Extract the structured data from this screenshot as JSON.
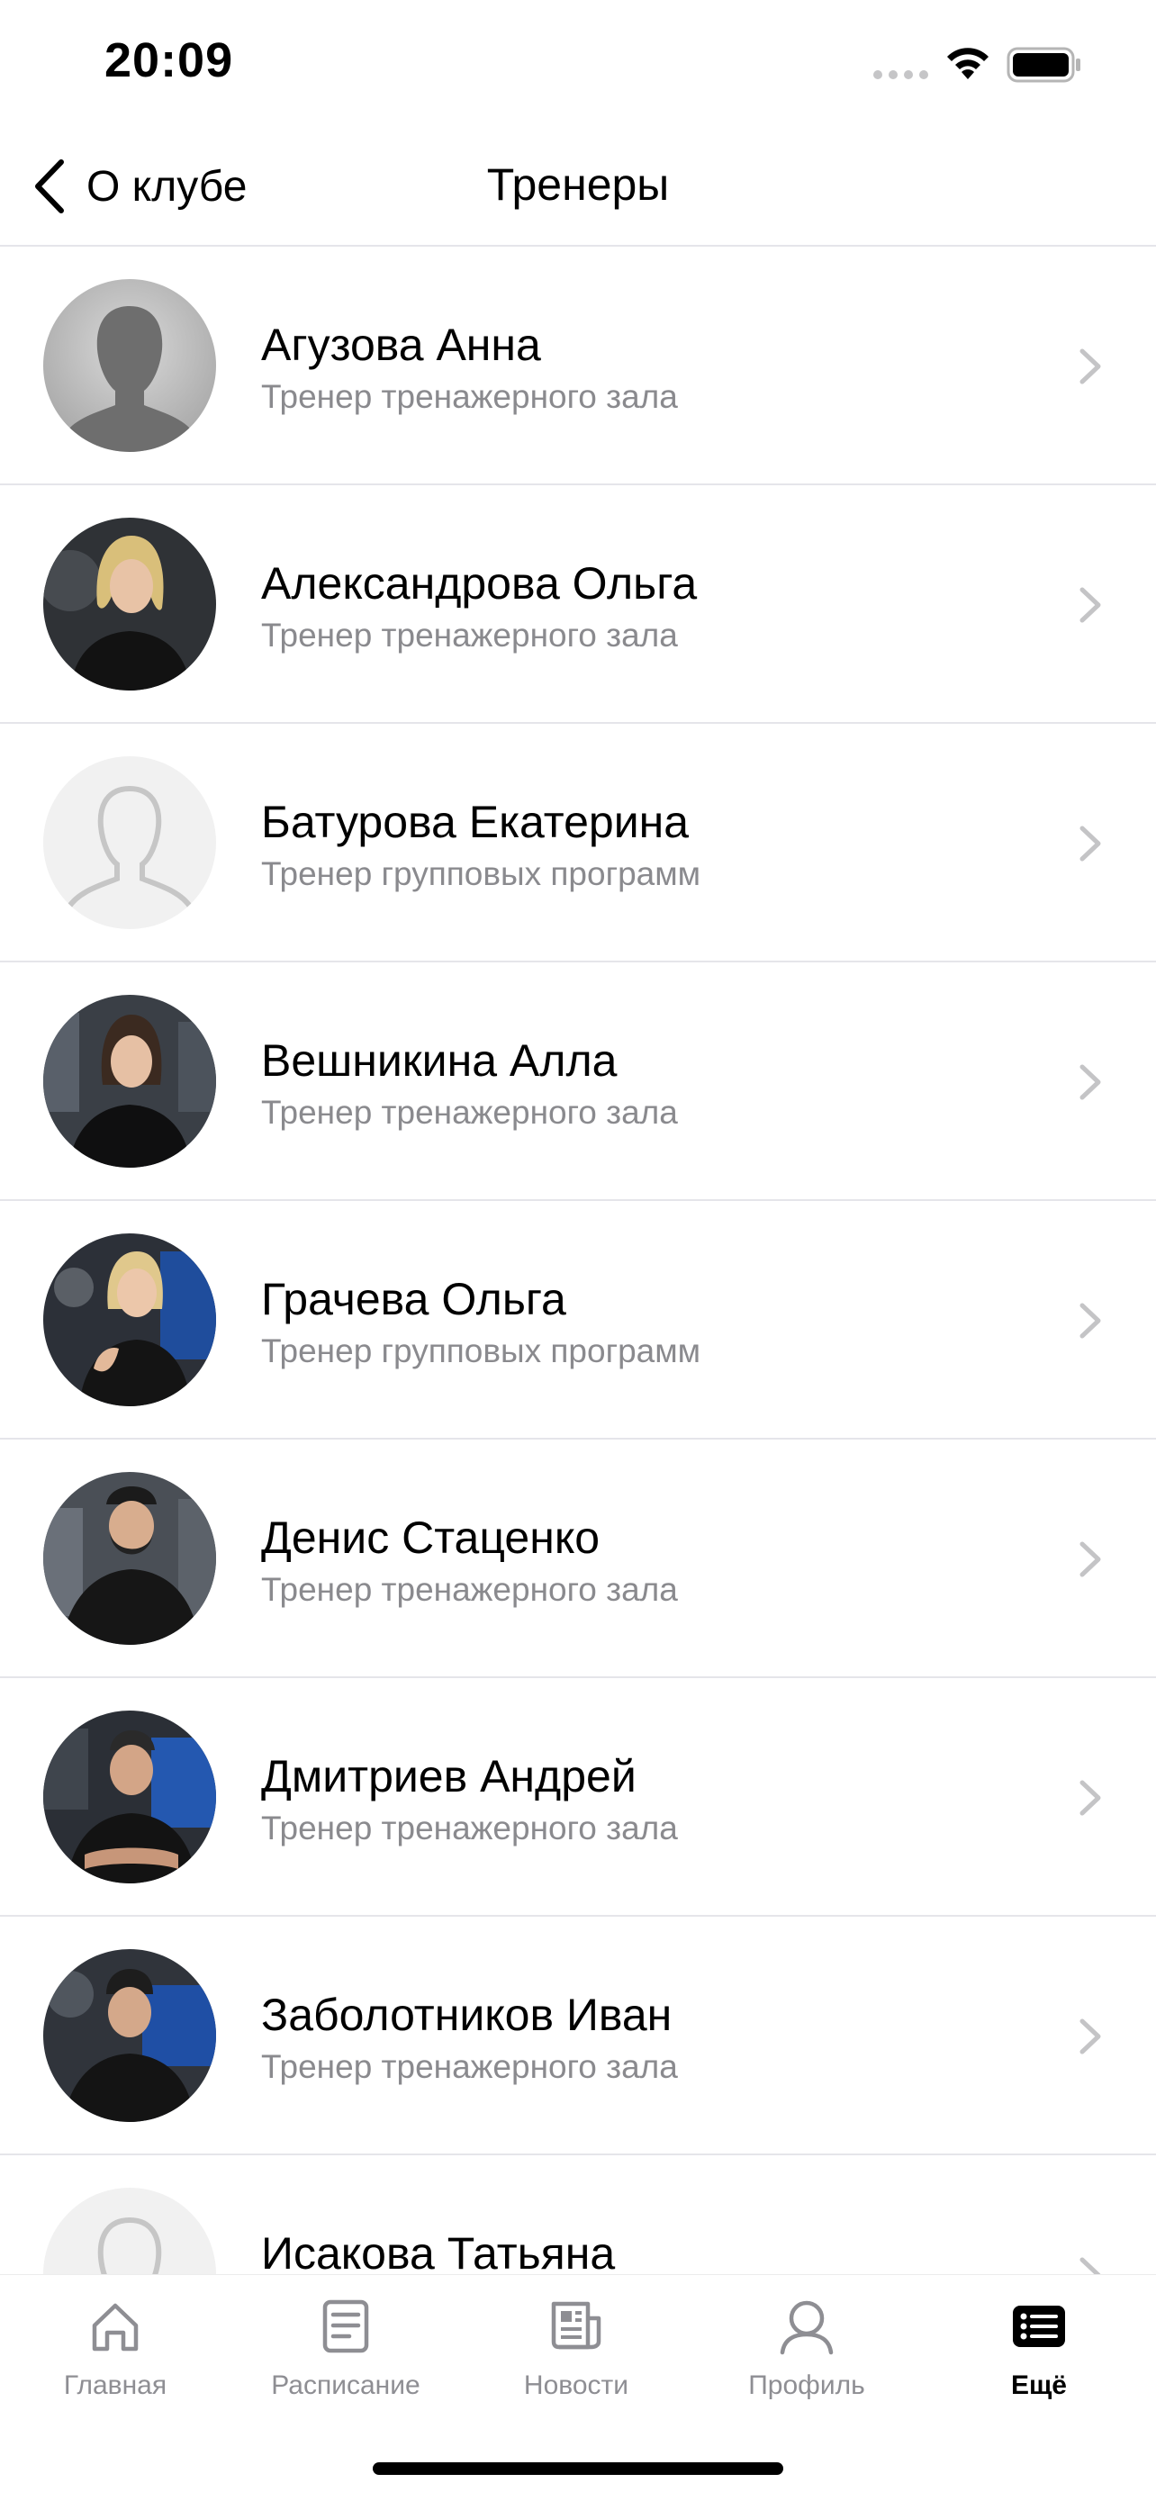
{
  "status_bar": {
    "time": "20:09"
  },
  "nav": {
    "back_label": "О клубе",
    "title": "Тренеры"
  },
  "trainers": [
    {
      "name": "Агузова Анна",
      "role": "Тренер тренажерного зала",
      "avatar": "placeholder-gray"
    },
    {
      "name": "Александрова Ольга",
      "role": "Тренер тренажерного зала",
      "avatar": "photo"
    },
    {
      "name": "Батурова Екатерина",
      "role": "Тренер групповых программ",
      "avatar": "placeholder-outline"
    },
    {
      "name": "Вешникина Алла",
      "role": "Тренер тренажерного зала",
      "avatar": "photo"
    },
    {
      "name": "Грачева Ольга",
      "role": "Тренер групповых программ",
      "avatar": "photo"
    },
    {
      "name": "Денис Стаценко",
      "role": "Тренер тренажерного зала",
      "avatar": "photo"
    },
    {
      "name": "Дмитриев Андрей",
      "role": "Тренер тренажерного зала",
      "avatar": "photo"
    },
    {
      "name": "Заболотников Иван",
      "role": "Тренер тренажерного зала",
      "avatar": "photo"
    },
    {
      "name": "Исакова Татьяна",
      "role": "",
      "avatar": "placeholder-outline"
    }
  ],
  "tabs": [
    {
      "label": "Главная",
      "icon": "home-icon",
      "active": false
    },
    {
      "label": "Расписание",
      "icon": "schedule-icon",
      "active": false
    },
    {
      "label": "Новости",
      "icon": "news-icon",
      "active": false
    },
    {
      "label": "Профиль",
      "icon": "profile-icon",
      "active": false
    },
    {
      "label": "Ещё",
      "icon": "more-icon",
      "active": true
    }
  ],
  "colors": {
    "secondary_text": "#8a8a8e",
    "separator": "#e5e5ea",
    "inactive_tab": "#8e8e93",
    "active_tab": "#000000"
  }
}
